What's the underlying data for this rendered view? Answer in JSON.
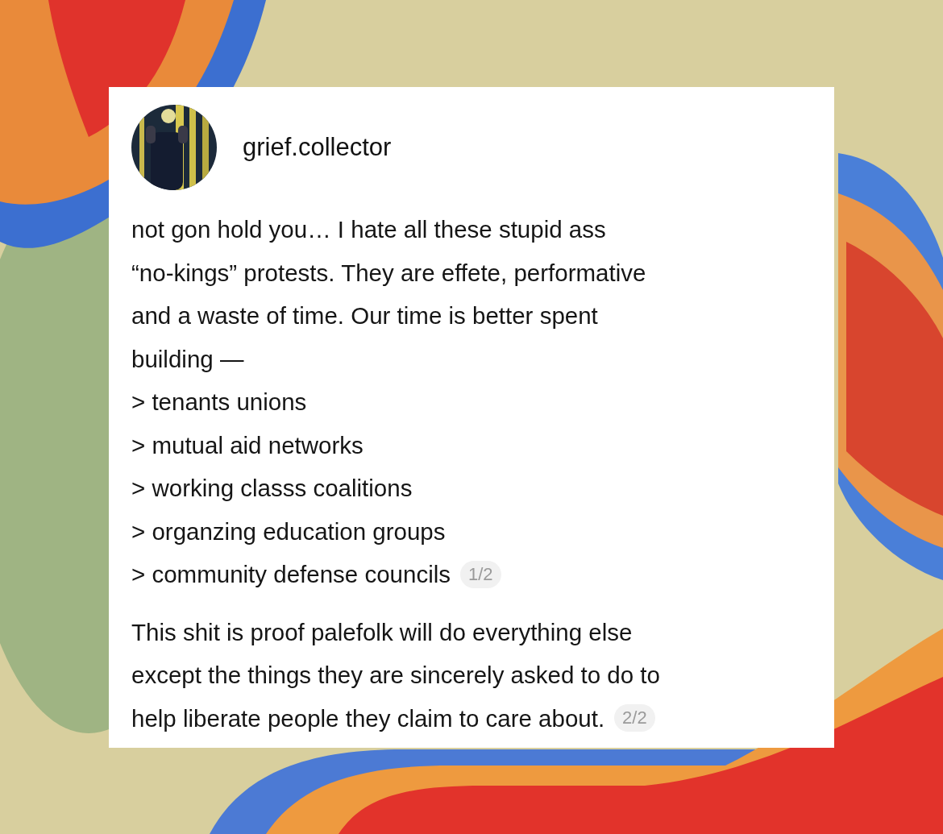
{
  "post": {
    "username": "grief.collector",
    "parts": [
      {
        "lines": [
          "not gon hold you… I hate all these stupid ass",
          "“no-kings” protests. They are effete, performative",
          "and a waste of time. Our time is better spent",
          "building —",
          "> tenants unions",
          "> mutual aid networks",
          "> working classs coalitions",
          "> organzing education groups",
          "> community defense councils"
        ],
        "counter": "1/2"
      },
      {
        "lines": [
          "This shit is proof palefolk will do everything else",
          "except the things they are sincerely asked to do to",
          "help liberate people they claim to care about."
        ],
        "counter": "2/2"
      }
    ]
  }
}
